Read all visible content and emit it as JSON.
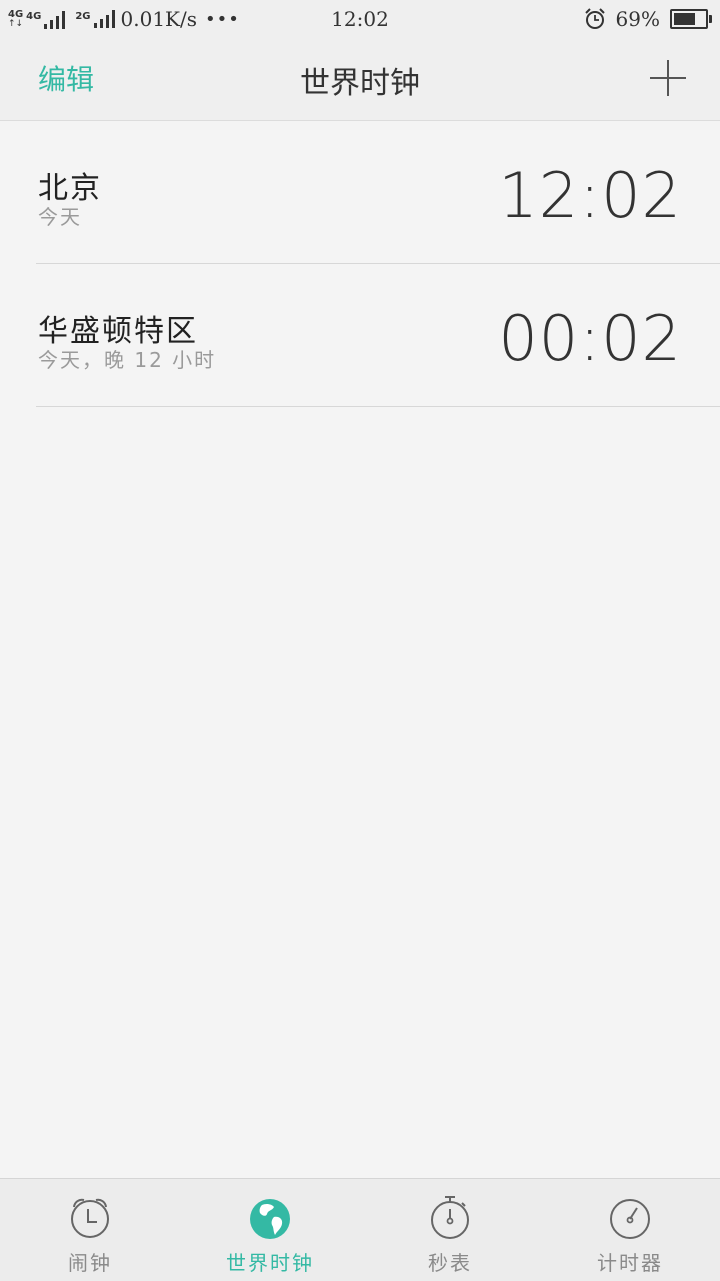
{
  "status_bar": {
    "network_left": "4G",
    "network_mid": "4G",
    "network_2g": "2G",
    "speed": "0.01K/s",
    "dots": "•••",
    "time": "12:02",
    "battery": "69%",
    "battery_level": 0.69
  },
  "header": {
    "edit_label": "编辑",
    "title": "世界时钟"
  },
  "clocks": [
    {
      "city": "北京",
      "sub": "今天",
      "time": "12:02"
    },
    {
      "city": "华盛顿特区",
      "sub": "今天，晚 12 小时",
      "time": "00:02"
    }
  ],
  "nav": {
    "alarm": "闹钟",
    "world_clock": "世界时钟",
    "stopwatch": "秒表",
    "timer": "计时器"
  },
  "colors": {
    "accent": "#34b9a4"
  }
}
